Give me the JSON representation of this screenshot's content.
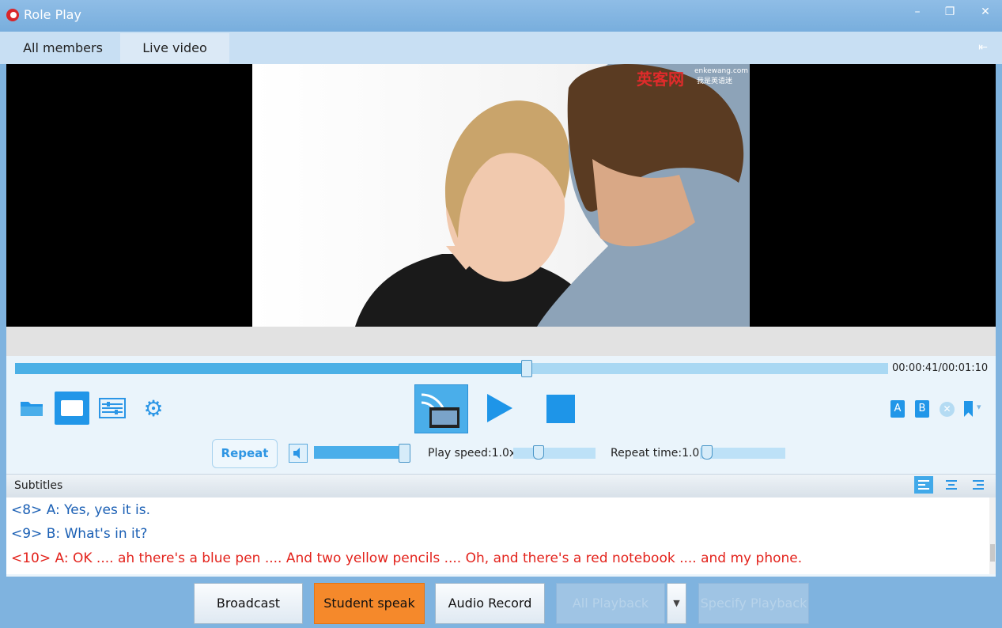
{
  "window": {
    "title": "Role Play",
    "controls": {
      "minimize": "–",
      "restore": "❐",
      "close": "✕"
    }
  },
  "tabs": [
    {
      "label": "All members",
      "active": false
    },
    {
      "label": "Live video",
      "active": true
    }
  ],
  "video": {
    "watermark_cn": "英客网",
    "watermark_en": "enkewang.com",
    "watermark_sub": "我是英语迷"
  },
  "player": {
    "time": "00:00:41/00:01:10",
    "progress": 0.585,
    "repeat_label": "Repeat",
    "volume": 0.9,
    "play_speed_label": "Play speed:1.0x",
    "play_speed": 0.3,
    "repeat_time_label": "Repeat time:1.0x",
    "repeat_time": 0.02,
    "role_a": "A",
    "role_b": "B"
  },
  "subtitles": {
    "header": "Subtitles",
    "lines": [
      {
        "text": "<8> A: Yes, yes it is.",
        "color": "#1a5fb4"
      },
      {
        "text": "<9> B: What's in it?",
        "color": "#1a5fb4"
      },
      {
        "text": "<10> A: OK .... ah there's a blue pen ....  And two yellow pencils ....  Oh, and there's a red notebook .... and my phone.",
        "color": "#e3231c"
      }
    ]
  },
  "bottom_buttons": {
    "broadcast": "Broadcast",
    "student_speak": "Student speak",
    "audio_record": "Audio Record",
    "all_playback": "All Playback",
    "specify_playback": "Specify Playback"
  },
  "colors": {
    "accent": "#2196e8",
    "active_button": "#f5892b",
    "titlebar": "#7fb3df"
  }
}
